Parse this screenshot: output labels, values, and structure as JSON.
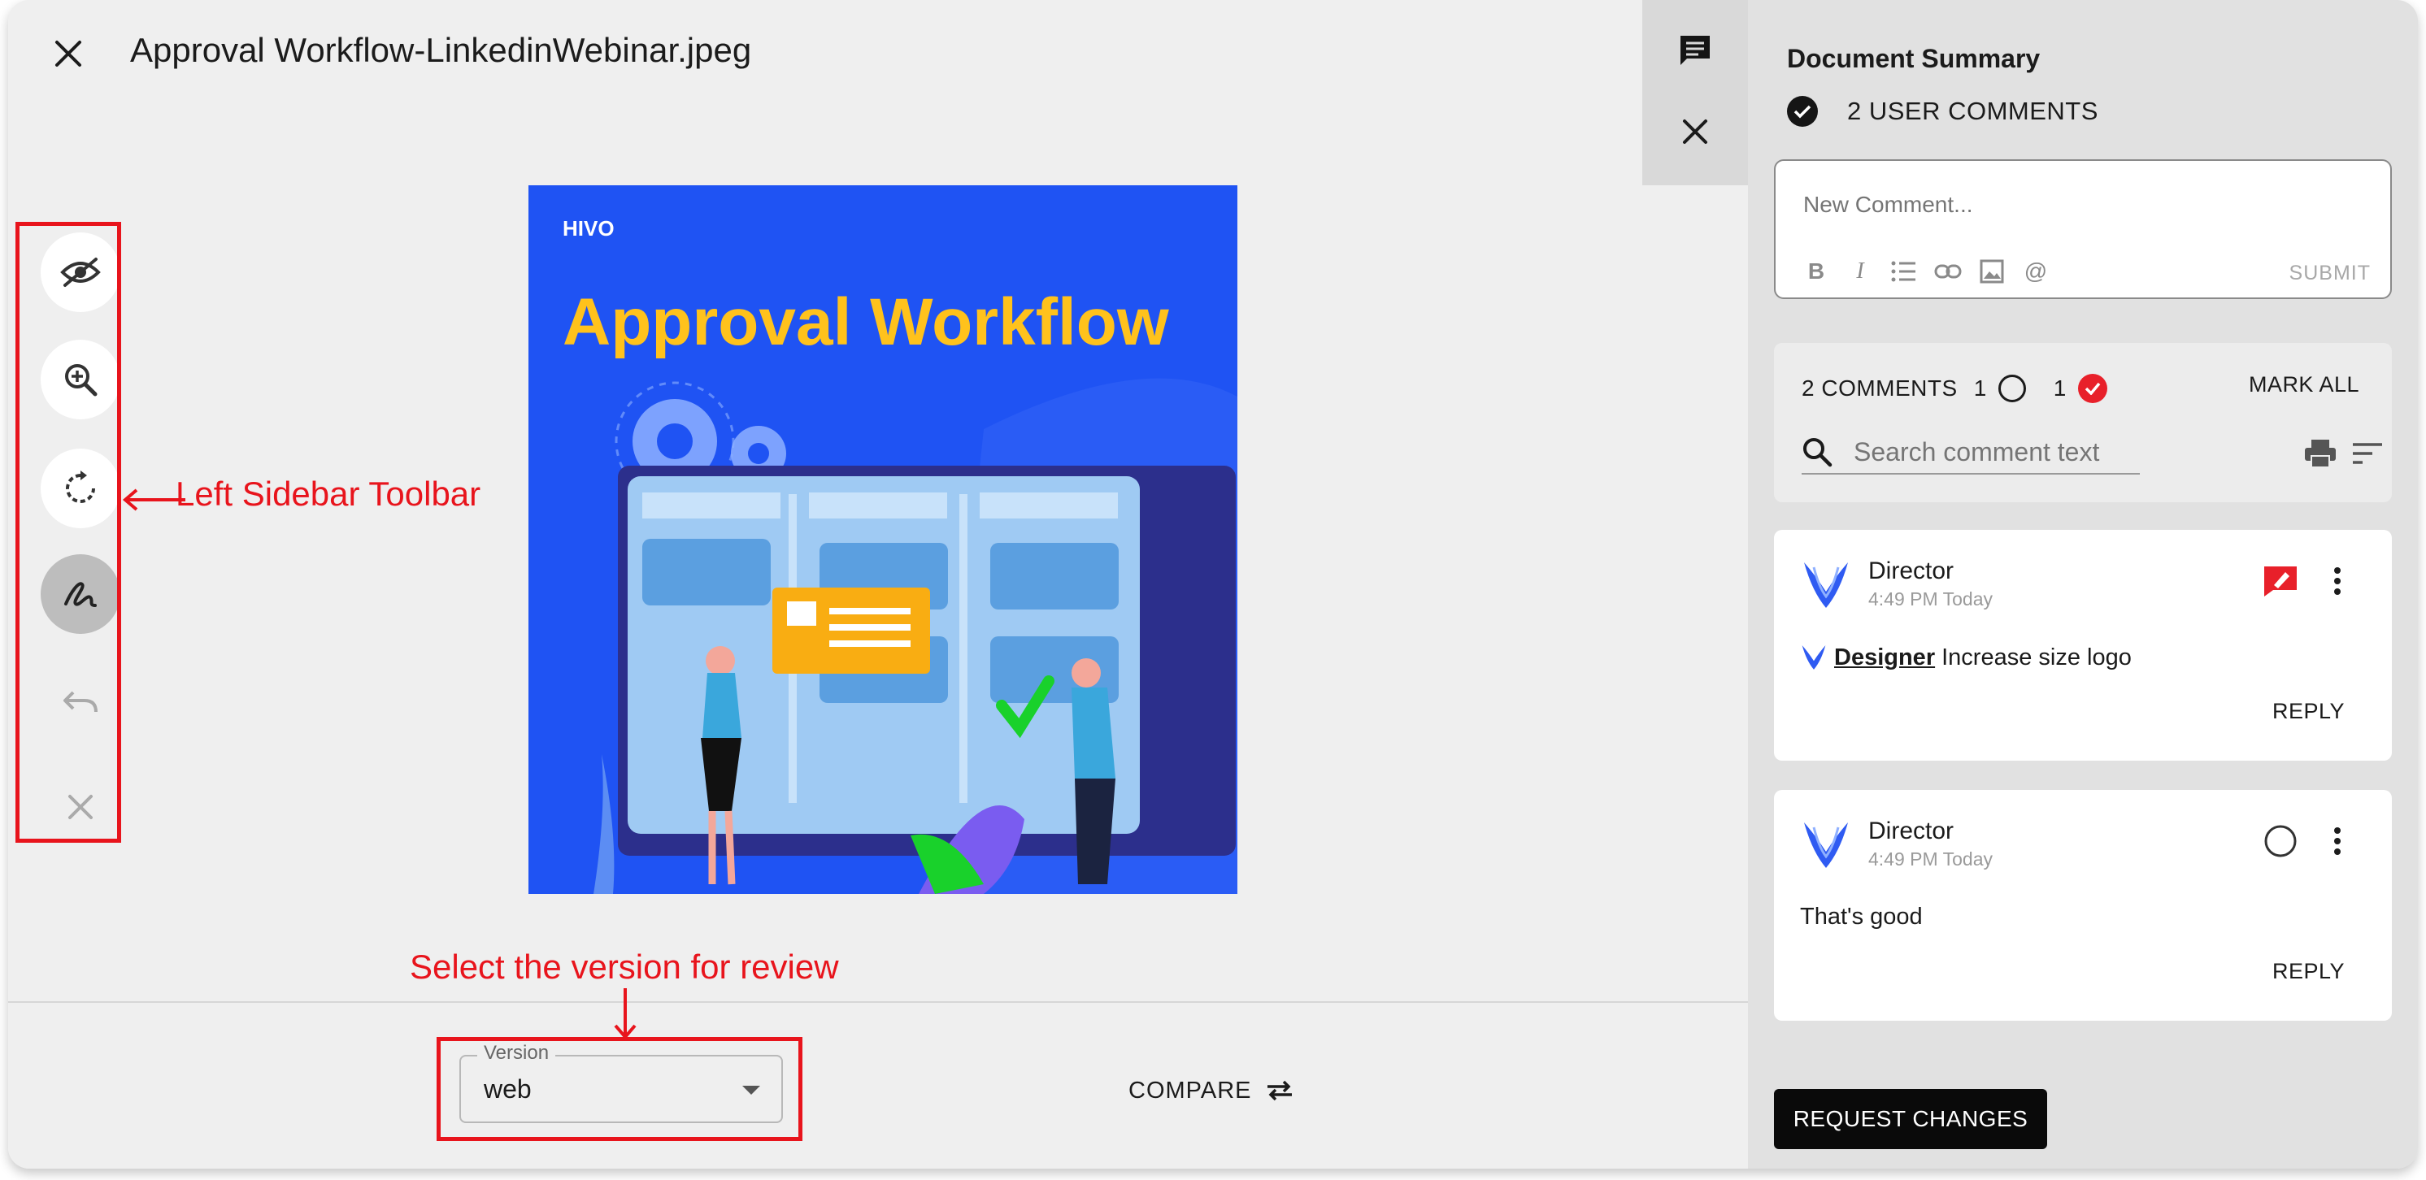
{
  "header": {
    "file_title": "Approval Workflow-LinkedinWebinar.jpeg"
  },
  "toolbar": {
    "tools": [
      {
        "name": "hide-annotations",
        "icon": "eye-off-icon"
      },
      {
        "name": "zoom-in",
        "icon": "zoom-in-icon"
      },
      {
        "name": "rotate",
        "icon": "rotate-icon"
      },
      {
        "name": "draw",
        "icon": "pen-squiggle-icon",
        "active": true
      },
      {
        "name": "undo",
        "icon": "undo-icon",
        "disabled": true
      },
      {
        "name": "clear",
        "icon": "close-icon",
        "disabled": true
      }
    ]
  },
  "preview": {
    "brand": "HIVO",
    "headline": "Approval Workflow"
  },
  "footer": {
    "version_label": "Version",
    "version_value": "web",
    "compare_label": "COMPARE"
  },
  "annotations": {
    "toolbar_note": "Left Sidebar Toolbar",
    "version_note": "Select the version for review",
    "color": "#e8141c"
  },
  "panel": {
    "title": "Document Summary",
    "user_comments": "2 USER COMMENTS",
    "new_comment_placeholder": "New Comment...",
    "submit_label": "SUBMIT",
    "comments_count": "2 COMMENTS",
    "open_count": "1",
    "resolved_count": "1",
    "mark_all": "MARK ALL",
    "search_placeholder": "Search comment text",
    "comments": [
      {
        "author": "Director",
        "time": "4:49 PM Today",
        "mention": "Designer",
        "text": "Increase size logo",
        "reply": "REPLY",
        "status": "flagged"
      },
      {
        "author": "Director",
        "time": "4:49 PM Today",
        "mention": "",
        "text": "That's good",
        "reply": "REPLY",
        "status": "open"
      }
    ],
    "request_changes": "REQUEST CHANGES"
  },
  "colors": {
    "accent_red": "#e8202a",
    "preview_blue": "#1f53f3",
    "headline_yellow": "#ffc21c",
    "primary_black": "#0a0a0a"
  }
}
